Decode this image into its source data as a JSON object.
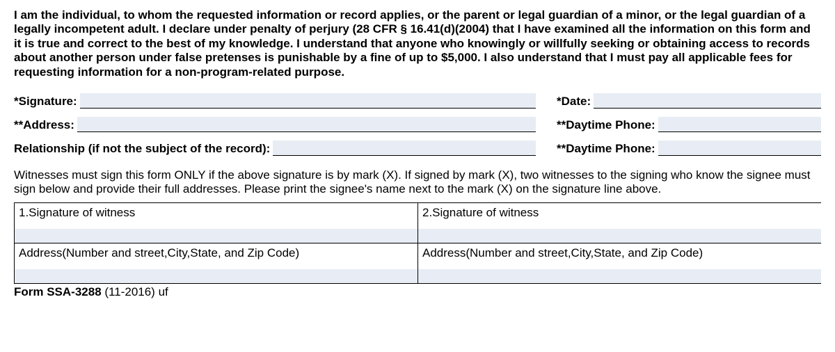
{
  "declaration": "I am the individual, to whom the requested information or record applies, or the parent or legal guardian of a minor, or the legal guardian of a legally incompetent adult. I declare under penalty of perjury (28 CFR § 16.41(d)(2004) that I have examined all the information on this form and it is true and correct to the best of my knowledge. I understand that anyone who knowingly or willfully seeking or obtaining access to records about another person under false pretenses is punishable by a fine of up to $5,000. I also understand that I must pay all applicable fees for requesting information for a non-program-related purpose.",
  "labels": {
    "signature": "*Signature:",
    "date": "*Date:",
    "address": "**Address:",
    "daytime_phone1": "**Daytime Phone:",
    "relationship": "Relationship (if not the subject of the record):",
    "daytime_phone2": "**Daytime Phone:"
  },
  "values": {
    "signature": "",
    "date": "",
    "address": "",
    "daytime_phone1": "",
    "relationship": "",
    "daytime_phone2": ""
  },
  "witness_instruction": "Witnesses must sign this form ONLY if the above signature is by mark (X). If signed by mark (X), two witnesses to the signing who know the signee must sign below and provide their full addresses. Please print the signee's name next to the mark (X) on the signature line above.",
  "witness1": {
    "sig_label": "1.Signature of witness",
    "addr_label": "Address(Number and street,City,State, and Zip Code)",
    "sig_value": "",
    "addr_value": ""
  },
  "witness2": {
    "sig_label": "2.Signature of witness",
    "addr_label": "Address(Number and street,City,State, and Zip Code)",
    "sig_value": "",
    "addr_value": ""
  },
  "footer": {
    "form_no": "Form SSA-3288",
    "rest": " (11-2016) uf"
  }
}
